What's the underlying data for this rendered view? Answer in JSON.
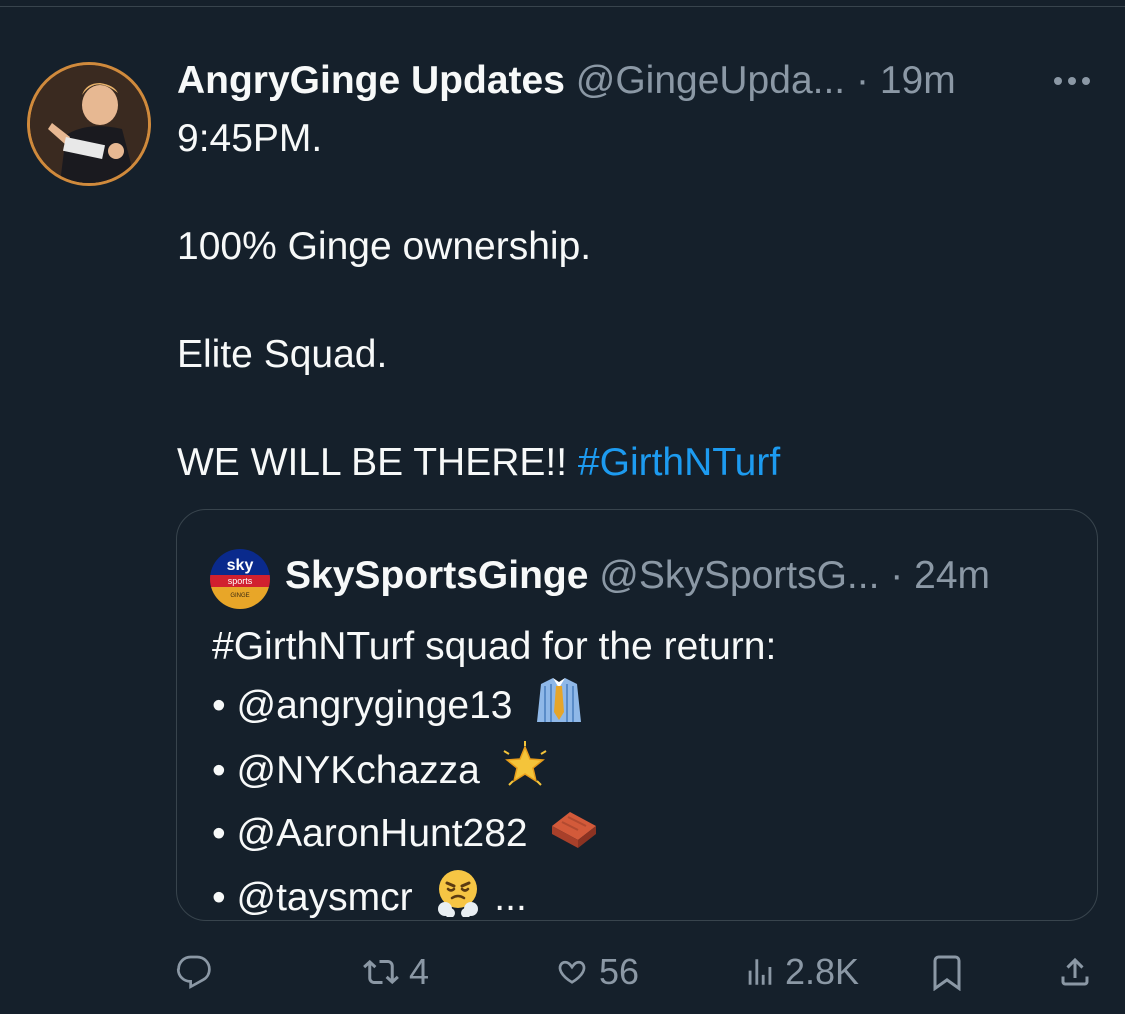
{
  "tweet": {
    "display_name": "AngryGinge Updates",
    "handle": "@GingeUpda...",
    "separator": "·",
    "time": "19m",
    "lines": [
      "9:45PM.",
      "100% Ginge ownership.",
      "Elite Squad.",
      "WE WILL BE THERE!!"
    ],
    "hashtag": "#GirthNTurf"
  },
  "quote": {
    "avatar_text_top": "sky",
    "avatar_text_mid": "sports",
    "avatar_text_bottom": "GINGE",
    "display_name": "SkySportsGinge",
    "handle": "@SkySportsG...",
    "separator": "·",
    "time": "24m",
    "intro": "#GirthNTurf squad for the return:",
    "bullets": [
      {
        "bullet": "•",
        "text": "@angryginge13",
        "emoji": "necktie-shirt-emoji"
      },
      {
        "bullet": "•",
        "text": "@NYKchazza",
        "emoji": "glowing-star-emoji"
      },
      {
        "bullet": "•",
        "text": "@AaronHunt282",
        "emoji": "brick-emoji"
      },
      {
        "bullet": "•",
        "text": "@taysmcr",
        "emoji": "steam-from-nose-emoji",
        "suffix": "..."
      }
    ]
  },
  "actions": {
    "reply_icon": "reply-icon",
    "retweet_icon": "retweet-icon",
    "retweet_count": "4",
    "like_icon": "heart-icon",
    "like_count": "56",
    "views_icon": "views-icon",
    "views_count": "2.8K",
    "bookmark_icon": "bookmark-icon",
    "share_icon": "share-icon"
  },
  "colors": {
    "background": "#15202b",
    "text": "#f7f9f9",
    "muted": "#8b98a5",
    "link": "#1d9bf0",
    "border": "#38444d",
    "avatar_ring": "#d08a3c"
  }
}
